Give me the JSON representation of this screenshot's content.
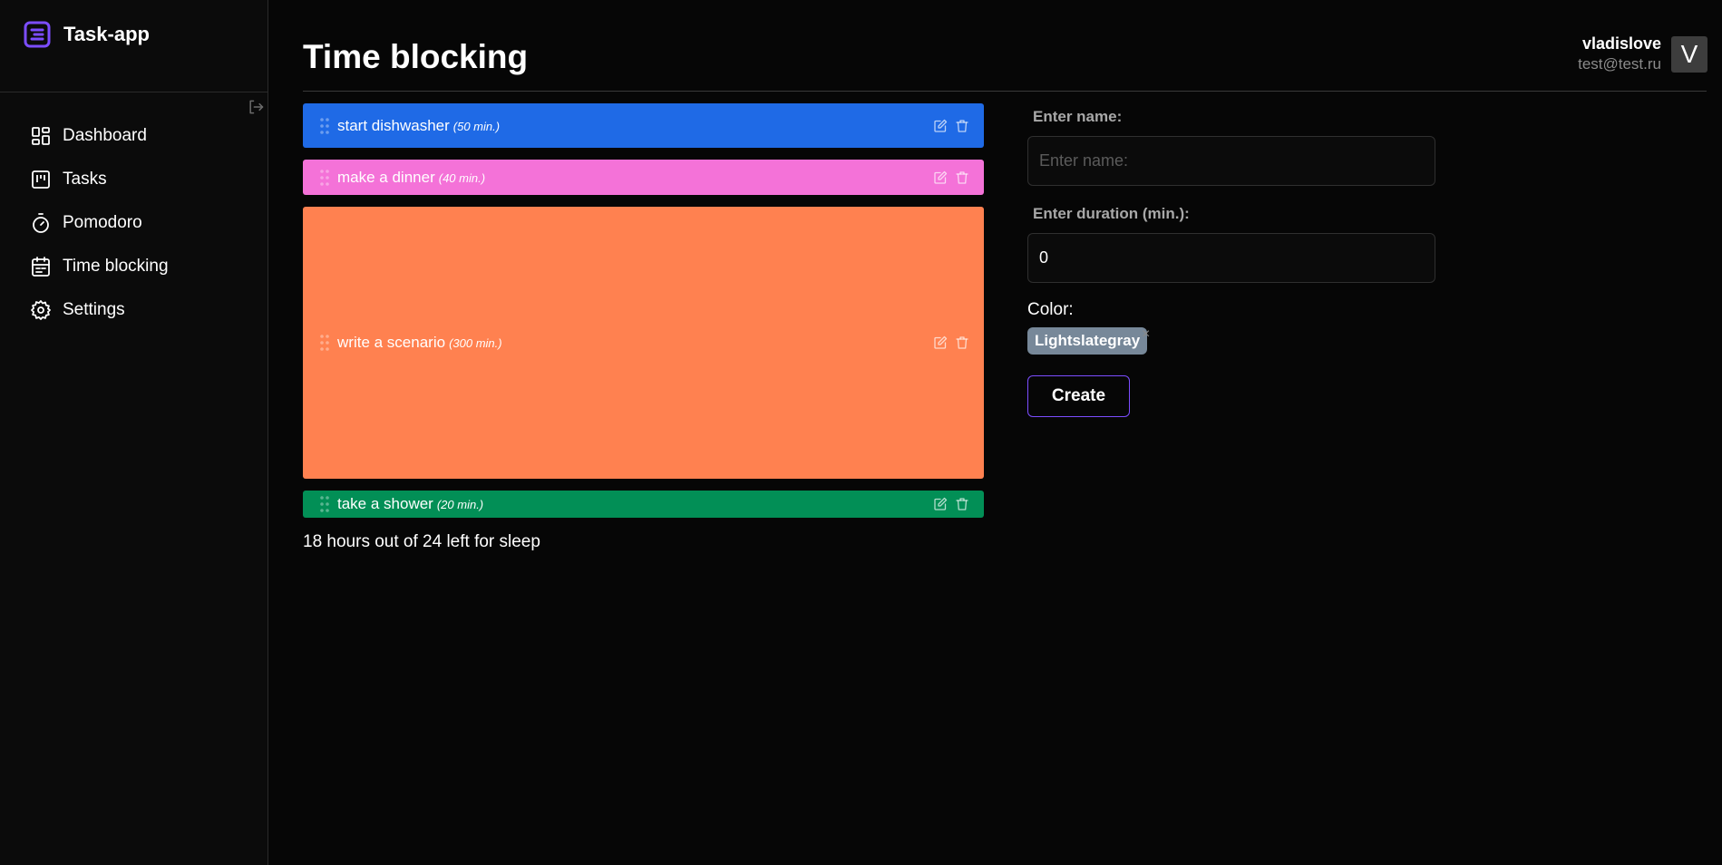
{
  "app": {
    "name": "Task-app",
    "accent": "#7c4dff"
  },
  "sidebar": {
    "items": [
      {
        "label": "Dashboard",
        "icon": "dashboard-icon"
      },
      {
        "label": "Tasks",
        "icon": "kanban-icon"
      },
      {
        "label": "Pomodoro",
        "icon": "timer-icon"
      },
      {
        "label": "Time blocking",
        "icon": "calendar-icon"
      },
      {
        "label": "Settings",
        "icon": "gear-icon"
      }
    ]
  },
  "header": {
    "title": "Time blocking"
  },
  "user": {
    "name": "vladislove",
    "email": "test@test.ru",
    "initial": "V"
  },
  "blocks": [
    {
      "name": "start dishwasher",
      "duration": "(50 min.)",
      "color": "#1f6ae6"
    },
    {
      "name": "make a dinner",
      "duration": "(40 min.)",
      "color": "#f472d8"
    },
    {
      "name": "write a scenario",
      "duration": "(300 min.)",
      "color": "#ff8150"
    },
    {
      "name": "take a shower",
      "duration": "(20 min.)",
      "color": "#028f56"
    }
  ],
  "summary": {
    "sleep_note": "18 hours out of 24 left for sleep"
  },
  "form": {
    "name_label": "Enter name:",
    "name_placeholder": "Enter name:",
    "name_value": "",
    "duration_label": "Enter duration (min.):",
    "duration_value": "0",
    "color_label": "Color:",
    "color_value": "Lightslategray",
    "color_hex": "#778899",
    "chip_close": "×",
    "create_label": "Create"
  }
}
